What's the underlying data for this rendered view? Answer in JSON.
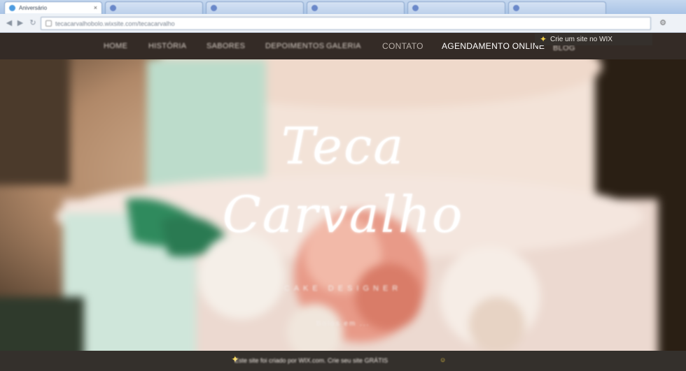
{
  "browser": {
    "tabs": [
      {
        "label": "Aniversário",
        "active": true
      },
      {
        "label": "",
        "active": false
      },
      {
        "label": "",
        "active": false
      },
      {
        "label": "",
        "active": false
      },
      {
        "label": "",
        "active": false
      },
      {
        "label": "",
        "active": false
      }
    ],
    "url": "tecacarvalhobolo.wixsite.com/tecacarvalho",
    "icons": {
      "back": "back-arrow-icon",
      "forward": "forward-arrow-icon",
      "reload": "reload-icon",
      "menu": "wrench-icon"
    }
  },
  "site_nav": {
    "items": [
      {
        "label": "HOME"
      },
      {
        "label": "HISTÓRIA"
      },
      {
        "label": "SABORES"
      },
      {
        "label": "DEPOIMENTOS"
      },
      {
        "label": "GALERIA"
      },
      {
        "label": "CONTATO"
      },
      {
        "label": "AGENDAMENTO ONLINE"
      },
      {
        "label": "BLOG"
      }
    ]
  },
  "wix_badge": {
    "label": "Crie um site no WIX"
  },
  "hero": {
    "title_line1": "Teca",
    "title_line2": "Carvalho",
    "tagline": "CAKE DESIGNER",
    "small": "Bolos em ..."
  },
  "bottom_bar": {
    "message": "Este site foi criado por WIX.com. Crie seu site GRÁTIS"
  },
  "colors": {
    "nav_bg": "#342b26",
    "bar_bg": "#34302c",
    "accent": "#f2cf45"
  }
}
